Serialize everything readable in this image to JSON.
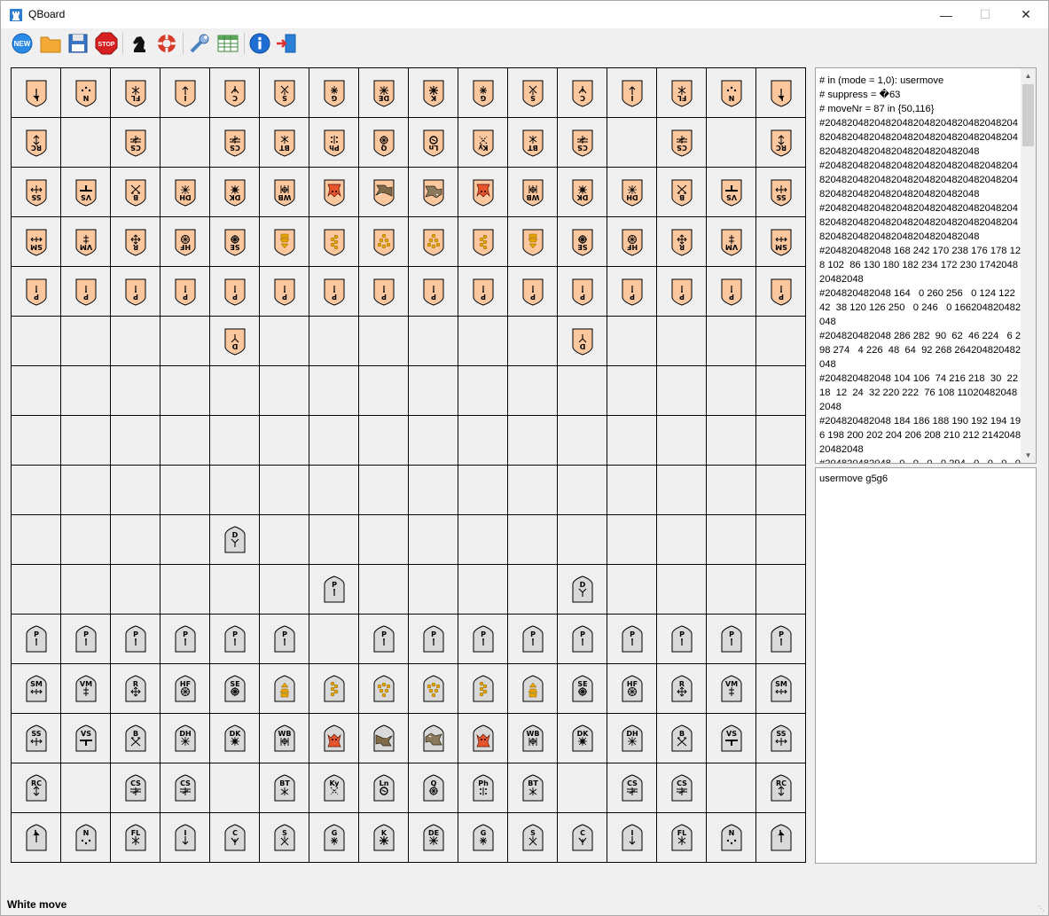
{
  "window": {
    "title": "QBoard"
  },
  "toolbar": {
    "buttons": [
      {
        "name": "new",
        "label": "NEW"
      },
      {
        "name": "open"
      },
      {
        "name": "save"
      },
      {
        "name": "stop",
        "label": "STOP"
      },
      {
        "name": "engine"
      },
      {
        "name": "help"
      },
      {
        "name": "settings"
      },
      {
        "name": "table"
      },
      {
        "name": "info"
      },
      {
        "name": "exit"
      }
    ]
  },
  "colors": {
    "black_piece": "#fbc79f",
    "white_piece": "#d9d9d9",
    "board": "#f0f0f0",
    "grid": "#000000",
    "devil": "#e8552c"
  },
  "board": {
    "files": 16,
    "ranks": 16,
    "rows": [
      [
        "bL",
        "bN",
        "bFL",
        "bI",
        "bC",
        "bS",
        "bG",
        "bDE",
        "bK",
        "bG",
        "bS",
        "bC",
        "bI",
        "bFL",
        "bN",
        "bL"
      ],
      [
        "bRC",
        "",
        "bCS",
        "",
        "bCS",
        "bBT",
        "bPh",
        "bQ",
        "bLn",
        "bKy",
        "bBT",
        "bCS",
        "",
        "bCS",
        "",
        "bRC"
      ],
      [
        "bSS",
        "bVS",
        "bB",
        "bDH",
        "bDK",
        "bWB",
        "bFD",
        "bFE",
        "bRH",
        "bFD",
        "bWB",
        "bDK",
        "bDH",
        "bB",
        "bVS",
        "bSS"
      ],
      [
        "bSM",
        "bVM",
        "bR",
        "bHF",
        "bSE",
        "bLH",
        "bLG",
        "bFK",
        "bFK",
        "bLG",
        "bLH",
        "bSE",
        "bHF",
        "bR",
        "bVM",
        "bSM"
      ],
      [
        "bP",
        "bP",
        "bP",
        "bP",
        "bP",
        "bP",
        "bP",
        "bP",
        "bP",
        "bP",
        "bP",
        "bP",
        "bP",
        "bP",
        "bP",
        "bP"
      ],
      [
        "",
        "",
        "",
        "",
        "bD",
        "",
        "",
        "",
        "",
        "",
        "",
        "bD",
        "",
        "",
        "",
        ""
      ],
      [
        "",
        "",
        "",
        "",
        "",
        "",
        "",
        "",
        "",
        "",
        "",
        "",
        "",
        "",
        "",
        ""
      ],
      [
        "",
        "",
        "",
        "",
        "",
        "",
        "",
        "",
        "",
        "",
        "",
        "",
        "",
        "",
        "",
        ""
      ],
      [
        "",
        "",
        "",
        "",
        "",
        "",
        "",
        "",
        "",
        "",
        "",
        "",
        "",
        "",
        "",
        ""
      ],
      [
        "",
        "",
        "",
        "",
        "wD",
        "",
        "",
        "",
        "",
        "",
        "",
        "",
        "",
        "",
        "",
        ""
      ],
      [
        "",
        "",
        "",
        "",
        "",
        "",
        "wP",
        "",
        "",
        "",
        "",
        "wD",
        "",
        "",
        "",
        ""
      ],
      [
        "wP",
        "wP",
        "wP",
        "wP",
        "wP",
        "wP",
        "",
        "wP",
        "wP",
        "wP",
        "wP",
        "wP",
        "wP",
        "wP",
        "wP",
        "wP"
      ],
      [
        "wSM",
        "wVM",
        "wR",
        "wHF",
        "wSE",
        "wLH",
        "wLG",
        "wFK",
        "wFK",
        "wLG",
        "wLH",
        "wSE",
        "wHF",
        "wR",
        "wVM",
        "wSM"
      ],
      [
        "wSS",
        "wVS",
        "wB",
        "wDH",
        "wDK",
        "wWB",
        "wFD",
        "wFE",
        "wRH",
        "wFD",
        "wWB",
        "wDK",
        "wDH",
        "wB",
        "wVS",
        "wSS"
      ],
      [
        "wRC",
        "",
        "wCS",
        "wCS",
        "",
        "wBT",
        "wKy",
        "wLn",
        "wQ",
        "wPh",
        "wBT",
        "",
        "wCS",
        "wCS",
        "",
        "wRC"
      ],
      [
        "wL",
        "wN",
        "wFL",
        "wI",
        "wC",
        "wS",
        "wG",
        "wK",
        "wDE",
        "wG",
        "wS",
        "wC",
        "wI",
        "wFL",
        "wN",
        "wL"
      ]
    ]
  },
  "piece_labels": {
    "L": "L",
    "N": "N",
    "FL": "FL",
    "I": "I",
    "C": "C",
    "S": "S",
    "G": "G",
    "DE": "DE",
    "K": "K",
    "RC": "RC",
    "CS": "CS",
    "BT": "BT",
    "Ph": "Ph",
    "Q": "Q",
    "Ln": "Ln",
    "Ky": "Ky",
    "SS": "SS",
    "VS": "VS",
    "B": "B",
    "DH": "DH",
    "DK": "DK",
    "WB": "WB",
    "SM": "SM",
    "VM": "VM",
    "R": "R",
    "HF": "HF",
    "SE": "SE",
    "P": "P",
    "D": "D"
  },
  "engine_log": {
    "lines": [
      "# in (mode = 1,0): usermove",
      "# suppress = �63",
      "# moveNr = 87 in {50,116}",
      "#2048204820482048204820482048204820482048204820482048204820482048204820482048204820482048204820482048",
      "#2048204820482048204820482048204820482048204820482048204820482048204820482048204820482048204820482048",
      "#2048204820482048204820482048204820482048204820482048204820482048204820482048204820482048204820482048",
      "#204820482048 168 242 170 238 176 178 128 102  86 130 180 182 234 172 230 174204820482048",
      "#204820482048 164   0 260 256   0 124 122  42  38 120 126 250   0 246   0 166204820482048",
      "#204820482048 286 282  90  62  46 224   6 298 274   4 226  48  64  92 268 264204820482048",
      "#204820482048 104 106  74 216 218  30  22  18  12  24  32 220 222  76 108 110204820482048",
      "#204820482048 184 186 188 190 192 194 196 198 200 202 204 206 208 210 212 214204820482048",
      "#204820482048   0   0   0   0 294   0   0   0   0"
    ]
  },
  "input": {
    "text": "usermove g5g6"
  },
  "status": {
    "text": "White move"
  }
}
